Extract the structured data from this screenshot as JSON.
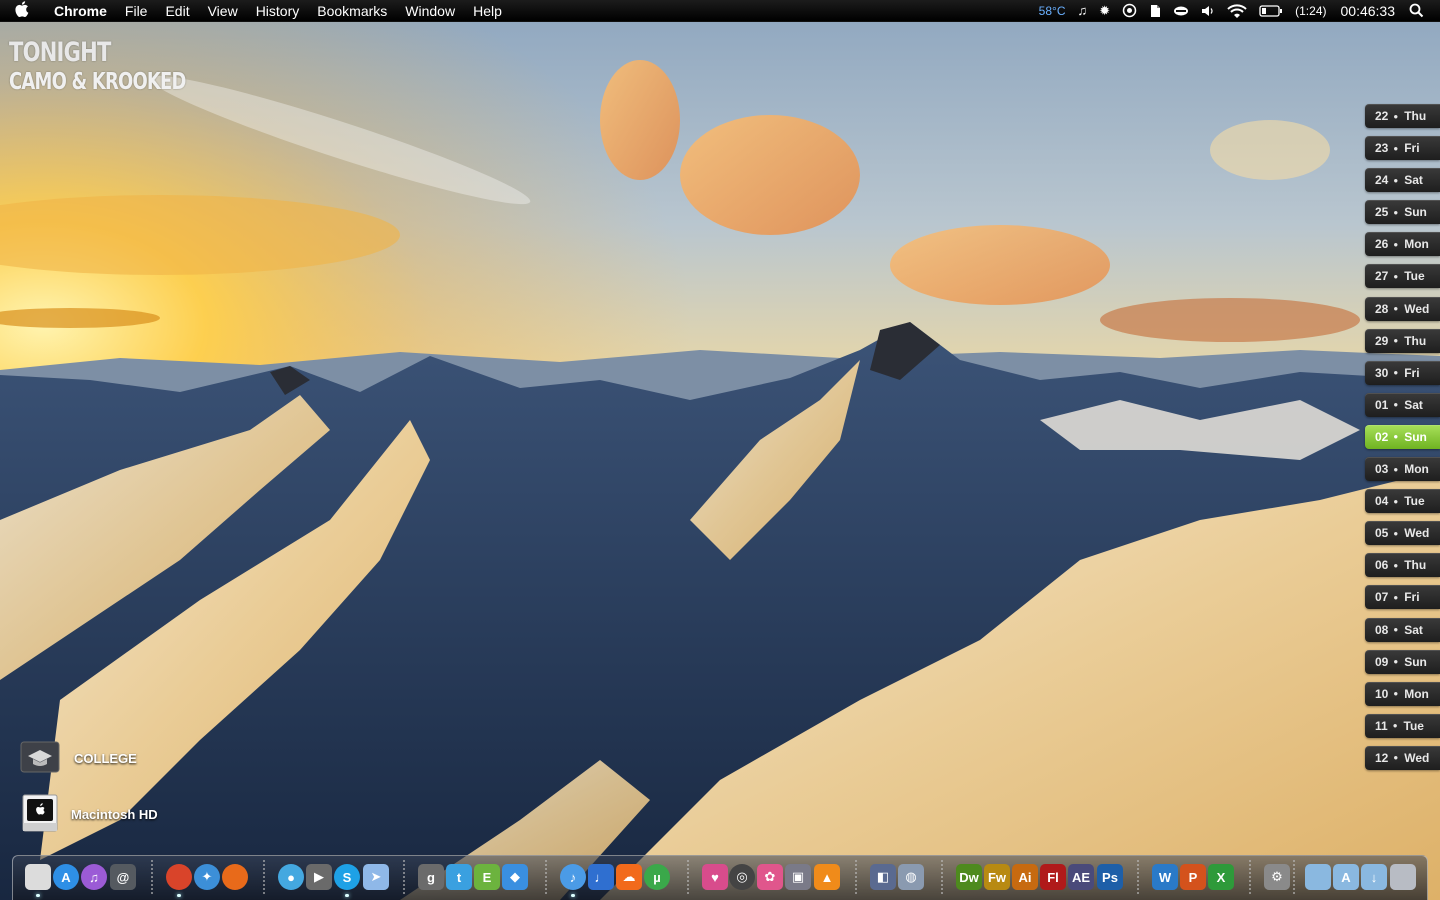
{
  "menubar": {
    "apple_icon": "apple-logo-icon",
    "app_name": "Chrome",
    "menus": [
      "File",
      "Edit",
      "View",
      "History",
      "Bookmarks",
      "Window",
      "Help"
    ],
    "temperature": "58°C",
    "battery_time": "(1:24)",
    "clock": "00:46:33",
    "status_icons": [
      "music-note-icon",
      "gear-icon",
      "sync-icon",
      "evernote-icon",
      "dropbox-icon",
      "volume-icon",
      "wifi-icon",
      "battery-icon",
      "spotlight-icon"
    ]
  },
  "now_playing": {
    "track": "TONIGHT",
    "artist": "CAMO & KROOKED"
  },
  "calendar": {
    "today_index": 10,
    "days": [
      {
        "date": "22",
        "day": "Thu"
      },
      {
        "date": "23",
        "day": "Fri"
      },
      {
        "date": "24",
        "day": "Sat"
      },
      {
        "date": "25",
        "day": "Sun"
      },
      {
        "date": "26",
        "day": "Mon"
      },
      {
        "date": "27",
        "day": "Tue"
      },
      {
        "date": "28",
        "day": "Wed"
      },
      {
        "date": "29",
        "day": "Thu"
      },
      {
        "date": "30",
        "day": "Fri"
      },
      {
        "date": "01",
        "day": "Sat"
      },
      {
        "date": "02",
        "day": "Sun"
      },
      {
        "date": "03",
        "day": "Mon"
      },
      {
        "date": "04",
        "day": "Tue"
      },
      {
        "date": "05",
        "day": "Wed"
      },
      {
        "date": "06",
        "day": "Thu"
      },
      {
        "date": "07",
        "day": "Fri"
      },
      {
        "date": "08",
        "day": "Sat"
      },
      {
        "date": "09",
        "day": "Sun"
      },
      {
        "date": "10",
        "day": "Mon"
      },
      {
        "date": "11",
        "day": "Tue"
      },
      {
        "date": "12",
        "day": "Wed"
      }
    ]
  },
  "desktop": {
    "college_label": "COLLEGE",
    "hd_label": "Macintosh HD"
  },
  "dock": {
    "items": [
      {
        "name": "finder-icon",
        "glyph": "",
        "color": "#dcdcdc",
        "running": true
      },
      {
        "name": "app-store-icon",
        "glyph": "A",
        "color": "#2e8fe6",
        "running": false
      },
      {
        "name": "itunes-store-icon",
        "glyph": "♫",
        "color": "#9b5bd6",
        "running": false
      },
      {
        "name": "mail-icon",
        "glyph": "@",
        "color": "#555a60",
        "running": false
      },
      {
        "name": "chrome-icon",
        "glyph": "",
        "color": "#d9442a",
        "running": true
      },
      {
        "name": "safari-icon",
        "glyph": "✦",
        "color": "#3c8fd8",
        "running": false
      },
      {
        "name": "firefox-icon",
        "glyph": "",
        "color": "#e86a1a",
        "running": false
      },
      {
        "name": "messenger-icon",
        "glyph": "●",
        "color": "#44a8e0",
        "running": false
      },
      {
        "name": "facetime-icon",
        "glyph": "▶",
        "color": "#6a6a6a",
        "running": false
      },
      {
        "name": "skype-icon",
        "glyph": "S",
        "color": "#1ea1e6",
        "running": true
      },
      {
        "name": "sparrow-icon",
        "glyph": "➤",
        "color": "#8fb8e8",
        "running": false
      },
      {
        "name": "growl-icon",
        "glyph": "g",
        "color": "#6b6b6b",
        "running": false
      },
      {
        "name": "twitter-icon",
        "glyph": "t",
        "color": "#3aa0e0",
        "running": false
      },
      {
        "name": "evernote-icon",
        "glyph": "E",
        "color": "#6cb33e",
        "running": false
      },
      {
        "name": "dropbox-icon",
        "glyph": "◆",
        "color": "#3a8fe0",
        "running": false
      },
      {
        "name": "itunes-icon",
        "glyph": "♪",
        "color": "#4b9be6",
        "running": true
      },
      {
        "name": "rdio-icon",
        "glyph": "♩",
        "color": "#2f6fd0",
        "running": false
      },
      {
        "name": "soundcloud-icon",
        "glyph": "☁",
        "color": "#f26a1b",
        "running": false
      },
      {
        "name": "utorrent-icon",
        "glyph": "µ",
        "color": "#3aa84a",
        "running": false
      },
      {
        "name": "heart-app-icon",
        "glyph": "♥",
        "color": "#d84c8c",
        "running": false
      },
      {
        "name": "aperture-icon",
        "glyph": "◎",
        "color": "#444",
        "running": false
      },
      {
        "name": "photos-icon",
        "glyph": "✿",
        "color": "#e0568c",
        "running": false
      },
      {
        "name": "imovie-icon",
        "glyph": "▣",
        "color": "#7a7a88",
        "running": false
      },
      {
        "name": "vlc-icon",
        "glyph": "▲",
        "color": "#f08b1a",
        "running": false
      },
      {
        "name": "final-cut-icon",
        "glyph": "◧",
        "color": "#5a6a90",
        "running": false
      },
      {
        "name": "color-app-icon",
        "glyph": "◍",
        "color": "#8a9ab0",
        "running": false
      },
      {
        "name": "dreamweaver-icon",
        "glyph": "Dw",
        "color": "#4e8a1e",
        "running": false
      },
      {
        "name": "fireworks-icon",
        "glyph": "Fw",
        "color": "#b88a12",
        "running": false
      },
      {
        "name": "illustrator-icon",
        "glyph": "Ai",
        "color": "#c76a10",
        "running": false
      },
      {
        "name": "flash-icon",
        "glyph": "Fl",
        "color": "#b01a1a",
        "running": false
      },
      {
        "name": "after-effects-icon",
        "glyph": "AE",
        "color": "#4a4a7a",
        "running": false
      },
      {
        "name": "photoshop-icon",
        "glyph": "Ps",
        "color": "#1e5fa8",
        "running": false
      },
      {
        "name": "word-icon",
        "glyph": "W",
        "color": "#2a7ac8",
        "running": false
      },
      {
        "name": "powerpoint-icon",
        "glyph": "P",
        "color": "#d4521c",
        "running": false
      },
      {
        "name": "excel-icon",
        "glyph": "X",
        "color": "#2e9a3a",
        "running": false
      },
      {
        "name": "system-preferences-icon",
        "glyph": "⚙",
        "color": "#8a8a8a",
        "running": false
      },
      {
        "name": "documents-folder-icon",
        "glyph": "",
        "color": "#8ab8e0",
        "running": false
      },
      {
        "name": "applications-folder-icon",
        "glyph": "A",
        "color": "#8ab8e0",
        "running": false
      },
      {
        "name": "downloads-folder-icon",
        "glyph": "↓",
        "color": "#8ab8e0",
        "running": false
      },
      {
        "name": "trash-icon",
        "glyph": "",
        "color": "#b8bcc4",
        "running": false
      }
    ]
  }
}
